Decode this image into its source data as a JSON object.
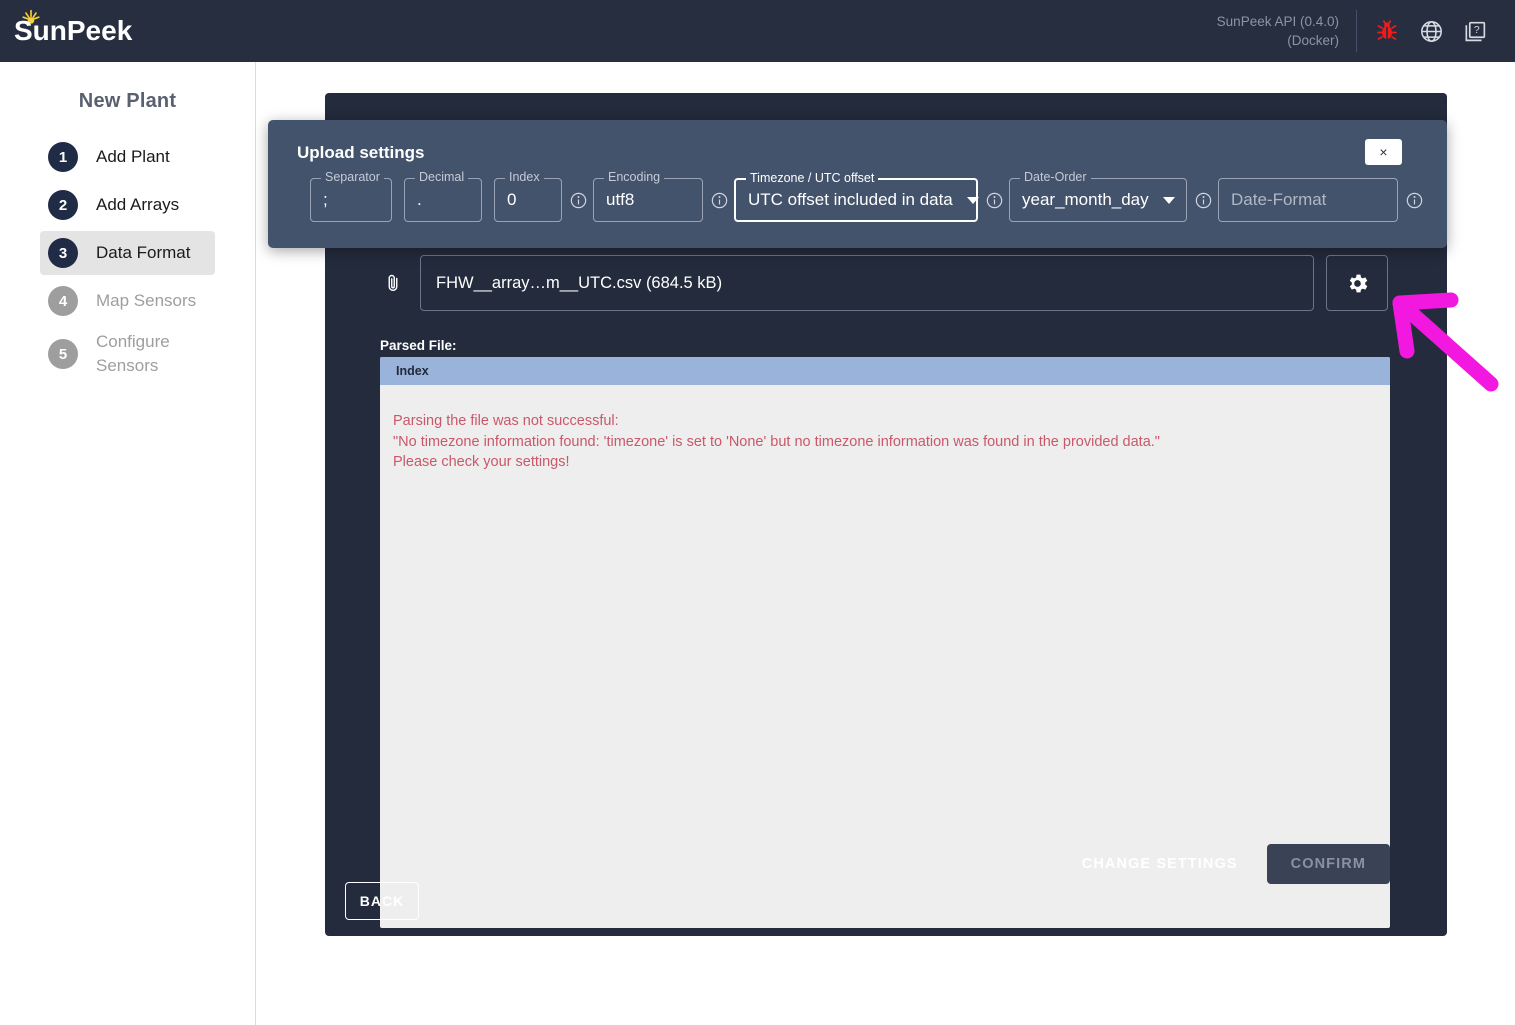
{
  "header": {
    "logo_text": "SunPeek",
    "logo_icon": "sun-icon",
    "api_line1": "SunPeek API (0.4.0)",
    "api_line2": "(Docker)",
    "icons": [
      "bug-icon",
      "globe-icon",
      "help-pages-icon"
    ],
    "bug_color": "#f01c1c"
  },
  "sidebar": {
    "title": "New Plant",
    "items": [
      {
        "num": "1",
        "label": "Add Plant",
        "state": "done"
      },
      {
        "num": "2",
        "label": "Add Arrays",
        "state": "done"
      },
      {
        "num": "3",
        "label": "Data Format",
        "state": "active"
      },
      {
        "num": "4",
        "label": "Map Sensors",
        "state": "disabled"
      },
      {
        "num": "5",
        "label": "Configure Sensors",
        "state": "disabled"
      }
    ]
  },
  "dialog": {
    "title": "Upload settings",
    "close_label": "×",
    "fields": [
      {
        "legend": "Separator",
        "value": ";",
        "type": "text",
        "info": false,
        "focused": false,
        "placeholder": false
      },
      {
        "legend": "Decimal",
        "value": ".",
        "type": "text",
        "info": false,
        "focused": false,
        "placeholder": false
      },
      {
        "legend": "Index",
        "value": "0",
        "type": "text",
        "info": true,
        "focused": false,
        "placeholder": false
      },
      {
        "legend": "Encoding",
        "value": "utf8",
        "type": "text",
        "info": true,
        "focused": false,
        "placeholder": false
      },
      {
        "legend": "Timezone / UTC offset",
        "value": "UTC offset included in data",
        "type": "select",
        "info": true,
        "focused": true,
        "placeholder": false
      },
      {
        "legend": "Date-Order",
        "value": "year_month_day",
        "type": "select",
        "info": true,
        "focused": false,
        "placeholder": false
      },
      {
        "legend": "",
        "value": "Date-Format",
        "type": "text",
        "info": true,
        "focused": false,
        "placeholder": true
      }
    ]
  },
  "main": {
    "file_icon": "paperclip-icon",
    "file_name": "FHW__array…m__UTC.csv (684.5 kB)",
    "settings_icon": "gear-icon",
    "parsed_label": "Parsed File:",
    "parsed_column": "Index",
    "error_lines": [
      "Parsing the file was not successful:",
      "\"No timezone information found: 'timezone' is set to 'None' but no timezone information was found in the provided data.\"",
      "Please check your settings!"
    ],
    "error_color": "#c9586a",
    "change_settings_label": "CHANGE SETTINGS",
    "confirm_label": "CONFIRM",
    "back_label": "BACK"
  },
  "annotation": {
    "type": "arrow",
    "color": "#f318e0",
    "points_to": "gear-icon"
  }
}
